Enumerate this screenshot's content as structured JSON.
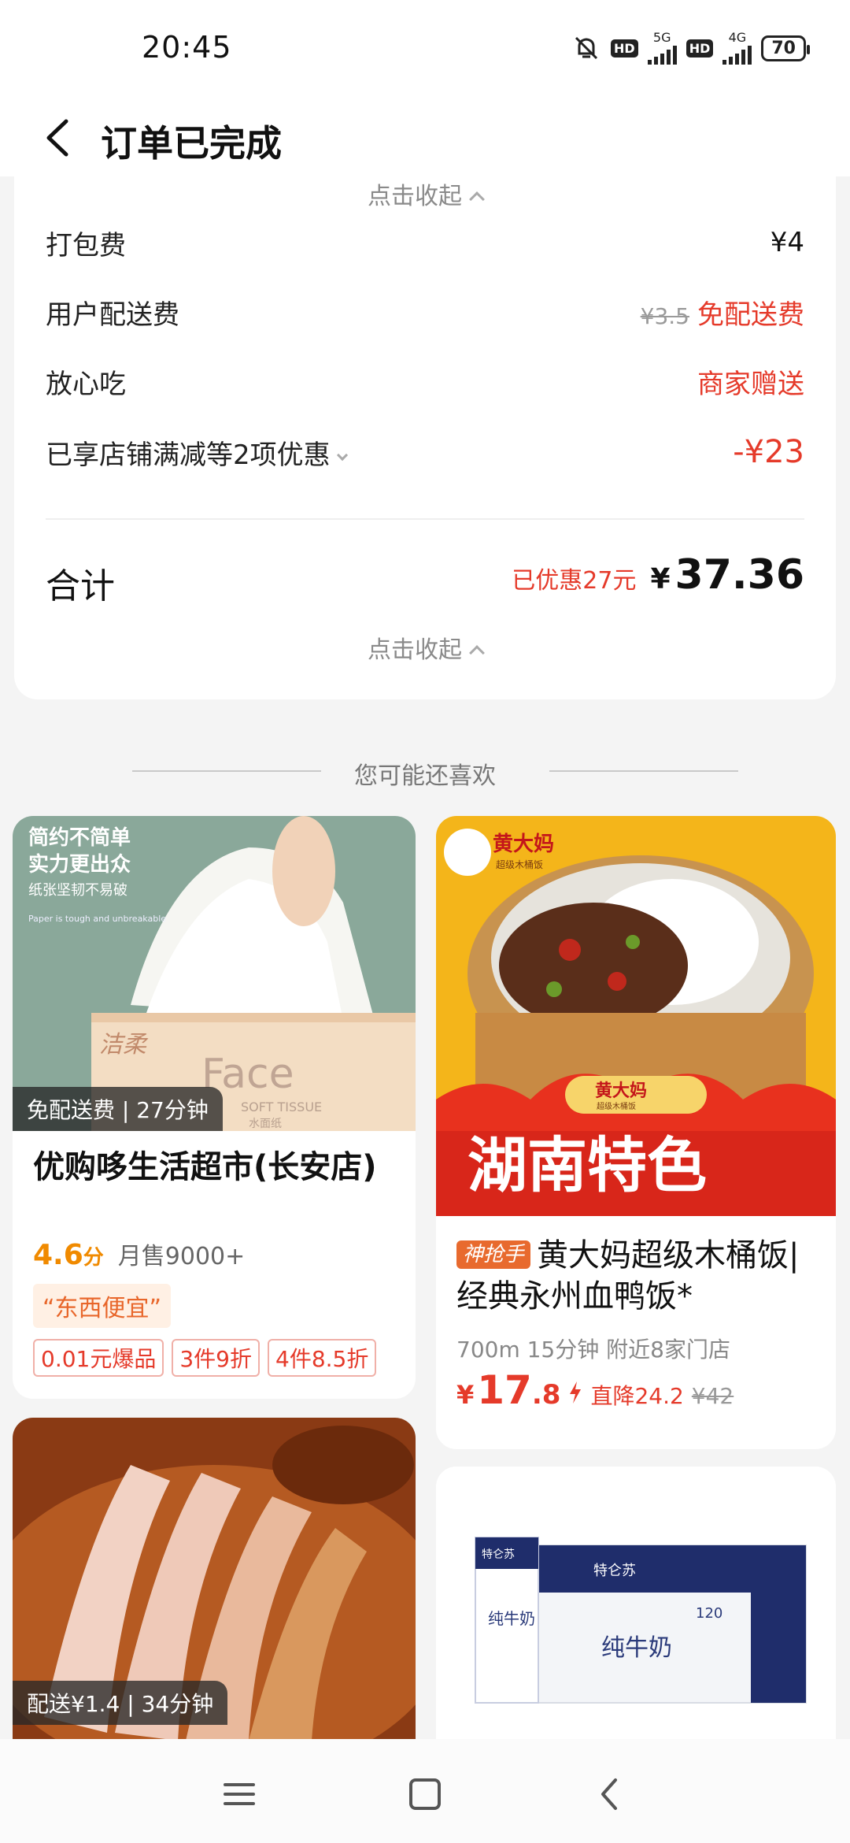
{
  "status_bar": {
    "time": "20:45",
    "hd1": "HD",
    "net1": "5G",
    "hd2": "HD",
    "net2": "4G",
    "battery": "70"
  },
  "header": {
    "title": "订单已完成"
  },
  "fee_card": {
    "collapse_top": "点击收起",
    "packing_label": "打包费",
    "packing_value": "¥4",
    "delivery_label": "用户配送费",
    "delivery_original": "¥3.5",
    "delivery_value": "免配送费",
    "assured_label": "放心吃",
    "assured_value": "商家赠送",
    "discount_label": "已享店铺满减等2项优惠",
    "discount_value": "-¥23",
    "total_label": "合计",
    "saved_text": "已优惠27元",
    "total_currency": "¥",
    "total_amount": "37.36",
    "collapse_bottom": "点击收起"
  },
  "recommend": {
    "heading": "您可能还喜欢"
  },
  "products": {
    "supermarket": {
      "image_text_1": "简约不简单",
      "image_text_2": "实力更出众",
      "image_text_3": "纸张坚韧不易破",
      "image_text_4": "Paper is tough and unbreakable",
      "image_brand": "洁柔",
      "image_face": "Face",
      "image_soft": "SOFT TISSUE",
      "image_cn": "水面纸",
      "delivery_tag": "免配送费 | 27分钟",
      "name": "优购哆生活超市(长安店)",
      "score": "4.6",
      "score_unit": "分",
      "monthly": "月售9000+",
      "quote": "“东西便宜”",
      "promos": [
        "0.01元爆品",
        "3件9折",
        "4件8.5折"
      ]
    },
    "rice": {
      "image_brand": "黄大妈",
      "image_sub": "超级木桶饭",
      "image_badge": "黄大妈",
      "image_badge_sub": "超级木桶饭",
      "image_slogan": "湖南特色",
      "badge": "神抢手",
      "name": "黄大妈超级木桶饭|经典永州血鸭饭*",
      "distance": "700m 15分钟 附近8家门店",
      "price_currency": "¥",
      "price_int": "17",
      "price_dec": ".8",
      "drop": "直降24.2",
      "original": "¥42"
    },
    "pork": {
      "delivery_tag": "配送¥1.4 | 34分钟"
    },
    "milk": {
      "box_brand": "特仑苏",
      "box_name": "纯牛奶",
      "box_count": "120",
      "carton_brand": "特仑苏",
      "carton_name": "纯牛奶"
    }
  },
  "colors": {
    "accent_red": "#e53a2a",
    "orange": "#f08a00"
  }
}
